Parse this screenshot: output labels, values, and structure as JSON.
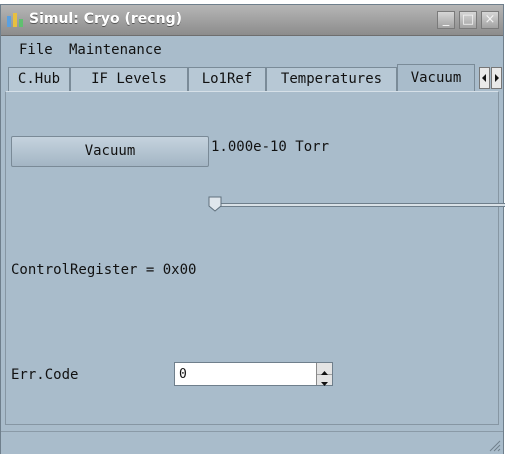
{
  "window": {
    "title": "Simul: Cryo (recng)",
    "controls": {
      "minimize": "_",
      "maximize": "□",
      "close": "×"
    }
  },
  "menu": {
    "file": "File",
    "maintenance": "Maintenance"
  },
  "tabs": [
    {
      "label": "C.Hub"
    },
    {
      "label": "IF Levels"
    },
    {
      "label": "Lo1Ref"
    },
    {
      "label": "Temperatures"
    },
    {
      "label": "Vacuum",
      "active": true
    }
  ],
  "tab_scroll": {
    "left_icon": "triangle-left",
    "right_icon": "triangle-right"
  },
  "vacuum_panel": {
    "button_label": "Vacuum",
    "reading": "1.000e-10 Torr",
    "slider_level": 0,
    "control_register": "ControlRegister = 0x00",
    "err_label": "Err.Code",
    "err_value": "0"
  },
  "colors": {
    "background": "#a9bccb",
    "titlebar": "#9c9c9c"
  }
}
